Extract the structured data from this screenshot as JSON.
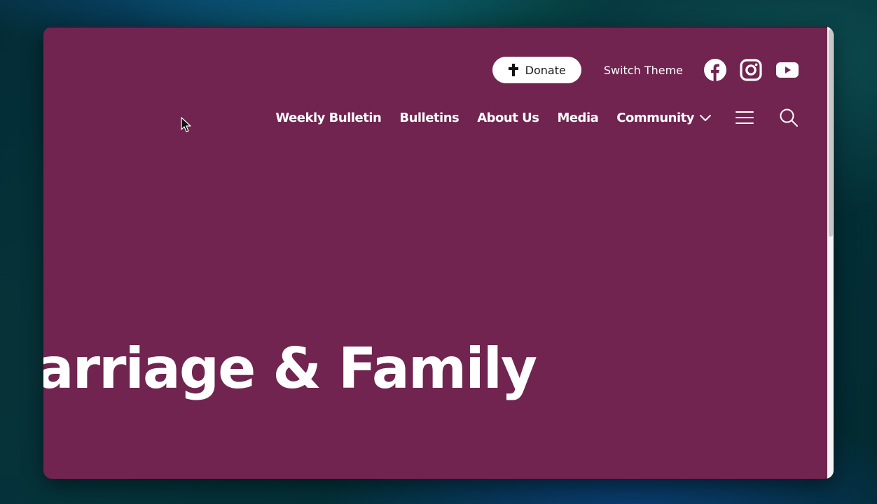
{
  "header": {
    "donate_label": "Donate",
    "switch_theme_label": "Switch Theme",
    "social": [
      "facebook-icon",
      "instagram-icon",
      "youtube-icon"
    ]
  },
  "nav": {
    "items": [
      {
        "label": "Weekly Bulletin"
      },
      {
        "label": "Bulletins"
      },
      {
        "label": "About Us"
      },
      {
        "label": "Media"
      },
      {
        "label": "Community"
      }
    ],
    "menu_icon": "hamburger-menu-icon",
    "search_icon": "search-icon"
  },
  "hero": {
    "title": "Marriage & Family"
  },
  "colors": {
    "page_background": "#70244f",
    "button_background": "#ffffff",
    "text": "#ffffff"
  }
}
